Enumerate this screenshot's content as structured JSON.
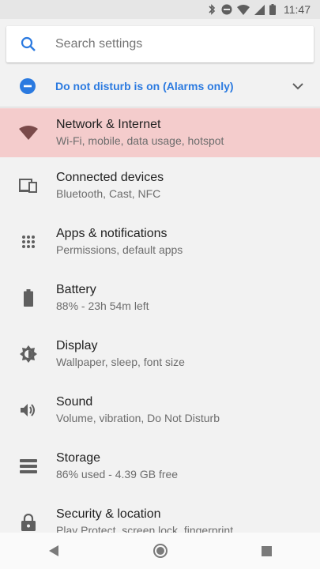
{
  "status_bar": {
    "time": "11:47"
  },
  "search": {
    "placeholder": "Search settings"
  },
  "dnd": {
    "text": "Do not disturb is on (Alarms only)"
  },
  "items": [
    {
      "title": "Network & Internet",
      "subtitle": "Wi-Fi, mobile, data usage, hotspot",
      "icon": "wifi-icon",
      "highlighted": true
    },
    {
      "title": "Connected devices",
      "subtitle": "Bluetooth, Cast, NFC",
      "icon": "devices-icon"
    },
    {
      "title": "Apps & notifications",
      "subtitle": "Permissions, default apps",
      "icon": "apps-grid-icon"
    },
    {
      "title": "Battery",
      "subtitle": "88% - 23h 54m left",
      "icon": "battery-icon"
    },
    {
      "title": "Display",
      "subtitle": "Wallpaper, sleep, font size",
      "icon": "brightness-icon"
    },
    {
      "title": "Sound",
      "subtitle": "Volume, vibration, Do Not Disturb",
      "icon": "volume-icon"
    },
    {
      "title": "Storage",
      "subtitle": "86% used - 4.39 GB free",
      "icon": "storage-icon"
    },
    {
      "title": "Security & location",
      "subtitle": "Play Protect, screen lock, fingerprint",
      "icon": "lock-icon"
    }
  ],
  "colors": {
    "accent": "#2b7ae0",
    "highlight": "#f4cccc",
    "icon": "#5f5f5f",
    "highlight_icon": "#7a4a4a"
  }
}
